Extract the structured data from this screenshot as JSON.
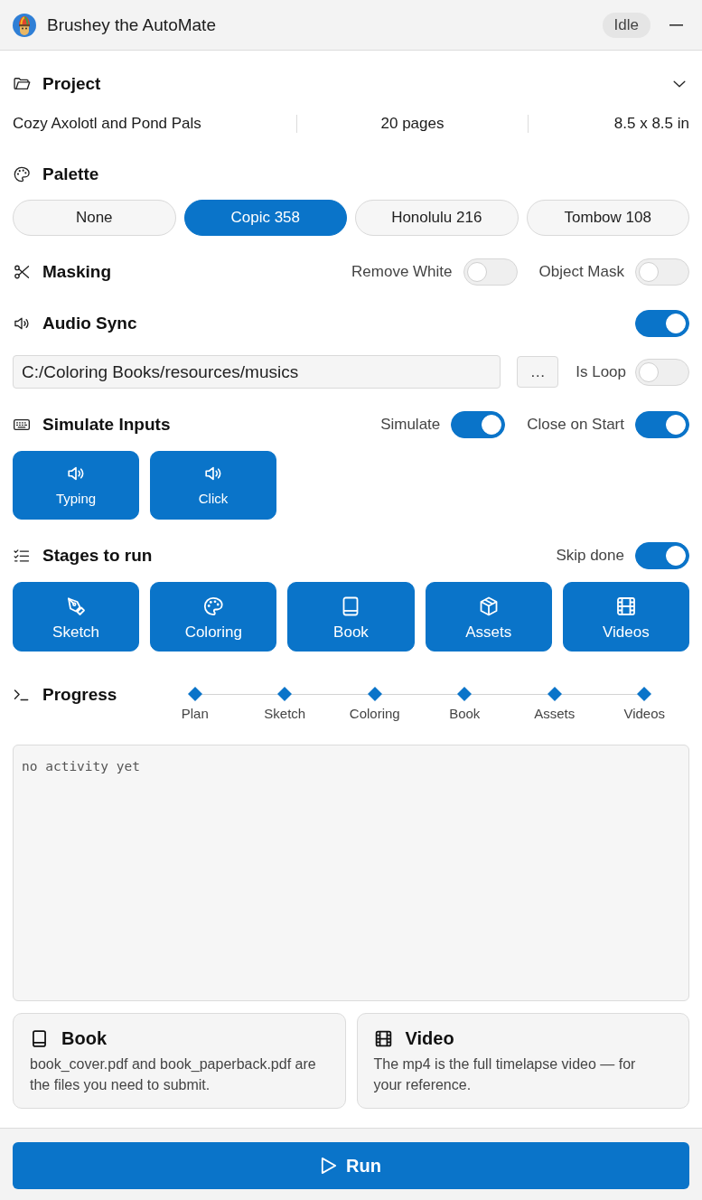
{
  "window": {
    "title": "Brushey the AutoMate",
    "status": "Idle"
  },
  "project": {
    "title": "Project",
    "name": "Cozy Axolotl and Pond Pals",
    "pages": "20 pages",
    "size": "8.5 x 8.5 in"
  },
  "palette": {
    "title": "Palette",
    "options": [
      {
        "label": "None",
        "selected": false
      },
      {
        "label": "Copic 358",
        "selected": true
      },
      {
        "label": "Honolulu 216",
        "selected": false
      },
      {
        "label": "Tombow 108",
        "selected": false
      }
    ]
  },
  "masking": {
    "title": "Masking",
    "toggles": [
      {
        "label": "Remove White",
        "on": false
      },
      {
        "label": "Object Mask",
        "on": false
      }
    ]
  },
  "audio_sync": {
    "title": "Audio Sync",
    "on": true,
    "path": "C:/Coloring Books/resources/musics",
    "browse": "…",
    "loop": {
      "label": "Is Loop",
      "on": false
    }
  },
  "simulate_inputs": {
    "title": "Simulate Inputs",
    "toggles": [
      {
        "label": "Simulate",
        "on": true
      },
      {
        "label": "Close on Start",
        "on": true
      }
    ],
    "sounds": [
      {
        "label": "Typing",
        "selected": true
      },
      {
        "label": "Click",
        "selected": true
      }
    ]
  },
  "stages": {
    "title": "Stages to run",
    "skip_done": {
      "label": "Skip done",
      "on": true
    },
    "items": [
      {
        "kind": "sketch",
        "label": "Sketch",
        "selected": true
      },
      {
        "kind": "coloring",
        "label": "Coloring",
        "selected": true
      },
      {
        "kind": "book",
        "label": "Book",
        "selected": true
      },
      {
        "kind": "assets",
        "label": "Assets",
        "selected": true
      },
      {
        "kind": "videos",
        "label": "Videos",
        "selected": true
      }
    ]
  },
  "progress": {
    "title": "Progress",
    "steps": [
      "Plan",
      "Sketch",
      "Coloring",
      "Book",
      "Assets",
      "Videos"
    ],
    "log": [
      "no activity yet"
    ]
  },
  "outputs": [
    {
      "kind": "book",
      "title": "Book",
      "text": "book_cover.pdf and book_paperback.pdf are the files you need to submit."
    },
    {
      "kind": "video",
      "title": "Video",
      "text": "The mp4 is the full timelapse video — for your reference."
    }
  ],
  "run_button": {
    "label": "Run"
  }
}
